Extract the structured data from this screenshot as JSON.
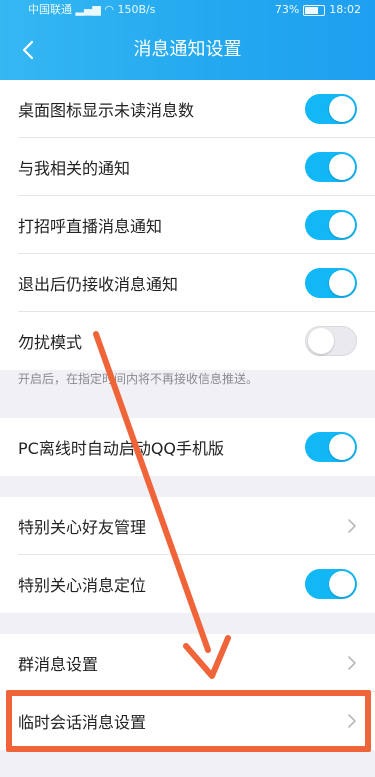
{
  "status_bar": {
    "carrier": "中国联通",
    "speed": "150B/s",
    "battery": "73%",
    "battery_level": 0.73,
    "time": "18:02"
  },
  "header": {
    "back_icon": "chevron-left-icon",
    "title": "消息通知设置"
  },
  "settings": [
    {
      "label": "桌面图标显示未读消息数",
      "type": "toggle",
      "on": true
    },
    {
      "label": "与我相关的通知",
      "type": "toggle",
      "on": true
    },
    {
      "label": "打招呼直播消息通知",
      "type": "toggle",
      "on": true
    },
    {
      "label": "退出后仍接收消息通知",
      "type": "toggle",
      "on": true
    },
    {
      "label": "勿扰模式",
      "type": "toggle",
      "on": false
    }
  ],
  "dnd_hint": "开启后，在指定时间内将不再接收信息推送。",
  "pc_offline": {
    "label": "PC离线时自动启动QQ手机版",
    "type": "toggle",
    "on": true
  },
  "special_care": [
    {
      "label": "特别关心好友管理",
      "type": "link"
    },
    {
      "label": "特别关心消息定位",
      "type": "toggle",
      "on": true
    }
  ],
  "group_settings": [
    {
      "label": "群消息设置",
      "type": "link"
    },
    {
      "label": "临时会话消息设置",
      "type": "link",
      "highlighted": true
    }
  ],
  "colors": {
    "accent": "#12b7f5",
    "annotation": "#f0643a",
    "header": "#23a8f0"
  }
}
